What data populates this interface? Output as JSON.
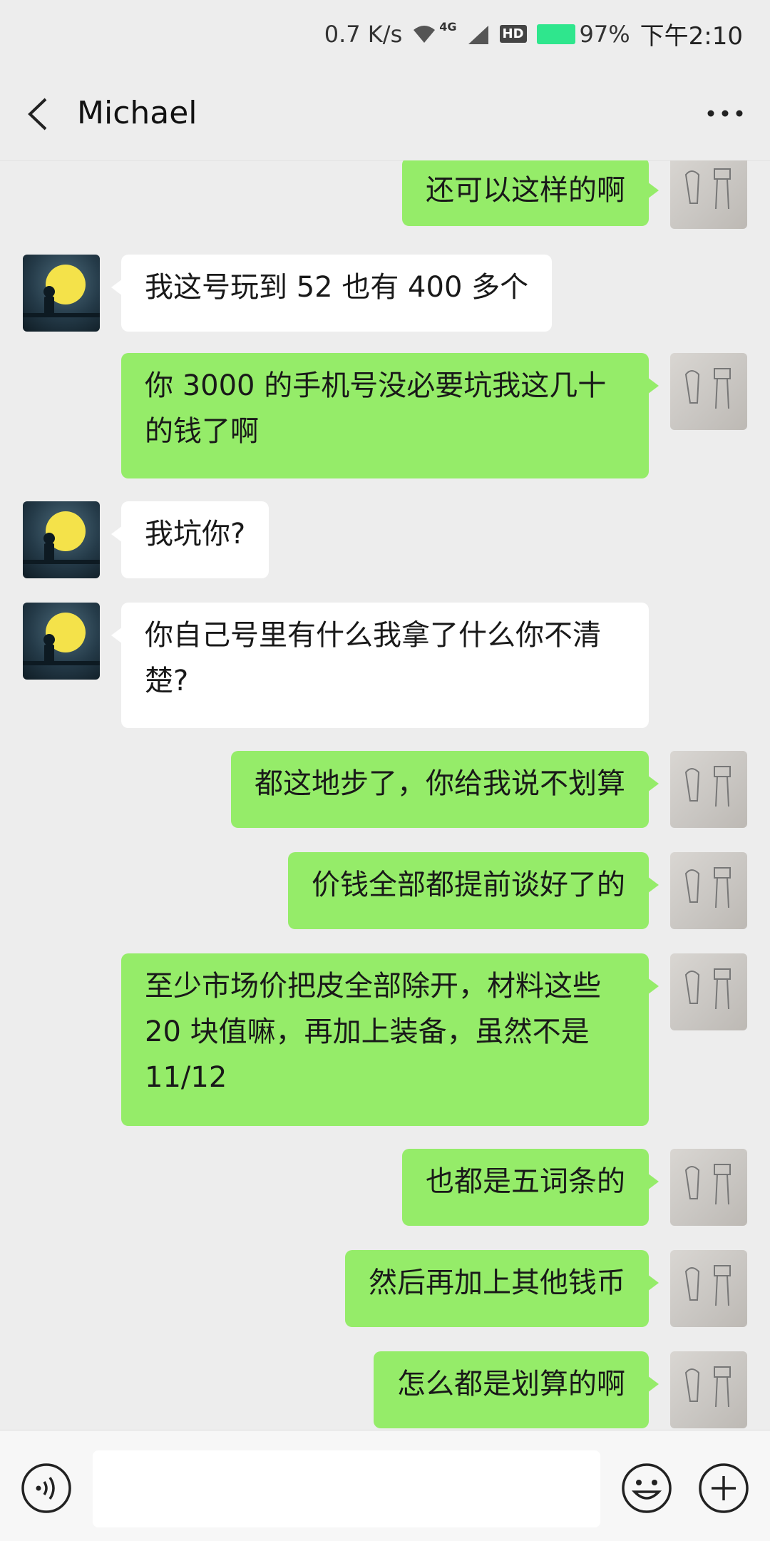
{
  "status_bar": {
    "network_speed": "0.7 K/s",
    "network_type": "4G",
    "hd_label": "HD",
    "battery": "97%",
    "time": "下午2:10",
    "battery_color": "#2fe68d"
  },
  "header": {
    "title": "Michael",
    "back_icon": "chevron-left-icon",
    "more_icon": "more-dots-icon"
  },
  "messages": [
    {
      "sender": "me",
      "text": "还可以这样的啊"
    },
    {
      "sender": "other",
      "text": "我这号玩到 52 也有 400 多个"
    },
    {
      "sender": "me",
      "text": "你 3000 的手机号没必要坑我这几十的钱了啊"
    },
    {
      "sender": "other",
      "text": "我坑你?"
    },
    {
      "sender": "other",
      "text": "你自己号里有什么我拿了什么你不清楚?"
    },
    {
      "sender": "me",
      "text": "都这地步了，你给我说不划算"
    },
    {
      "sender": "me",
      "text": "价钱全部都提前谈好了的"
    },
    {
      "sender": "me",
      "text": "至少市场价把皮全部除开，材料这些 20 块值嘛，再加上装备，虽然不是 11/12"
    },
    {
      "sender": "me",
      "text": "也都是五词条的"
    },
    {
      "sender": "me",
      "text": "然后再加上其他钱币"
    },
    {
      "sender": "me",
      "text": "怎么都是划算的啊"
    }
  ],
  "colors": {
    "my_bubble": "#95ec69",
    "other_bubble": "#ffffff",
    "background": "#ededed"
  },
  "input_bar": {
    "placeholder": "",
    "voice_icon": "voice-icon",
    "emoji_icon": "emoji-icon",
    "plus_icon": "plus-icon"
  }
}
